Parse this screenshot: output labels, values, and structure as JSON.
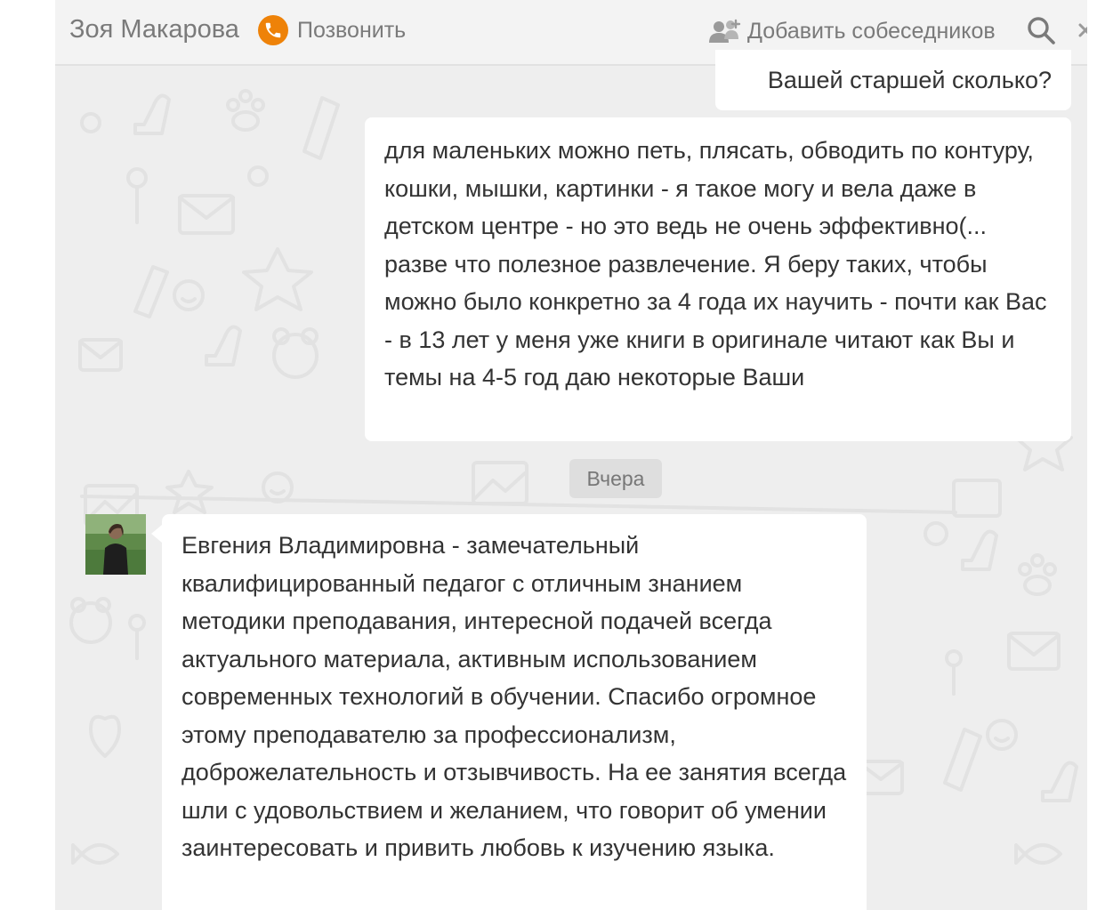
{
  "header": {
    "contact_name": "Зоя Макарова",
    "call_label": "Позвонить",
    "add_participants_label": "Добавить собеседников",
    "accent_color": "#ee8208"
  },
  "messages": [
    {
      "direction": "outgoing",
      "text": "Вашей старшей сколько?"
    },
    {
      "direction": "outgoing",
      "text": "для маленьких можно петь, плясать, обводить по контуру, кошки, мышки, картинки - я такое могу и вела даже в детском центре - но это ведь не очень эффективно(... разве что полезное развлечение. Я беру таких, чтобы можно было конкретно за 4 года их научить - почти как Вас - в 13 лет у меня уже книги в оригинале читают как Вы и темы на 4-5 год даю некоторые Ваши"
    },
    {
      "direction": "incoming",
      "text": "Евгения Владимировна - замечательный квалифицированный педагог с отличным знанием методики преподавания, интересной подачей всегда актуального материала, активным использованием современных технологий в обучении. Спасибо огромное этому преподавателю за профессионализм, доброжелательность и отзывчивость. На ее занятия всегда шли с удовольствием и желанием, что говорит об умении заинтересовать и привить любовь к изучению  языка."
    }
  ],
  "date_separator": "Вчера",
  "icons": {
    "call": "phone-icon",
    "add": "add-people-icon",
    "search": "search-icon",
    "close": "close-icon"
  }
}
